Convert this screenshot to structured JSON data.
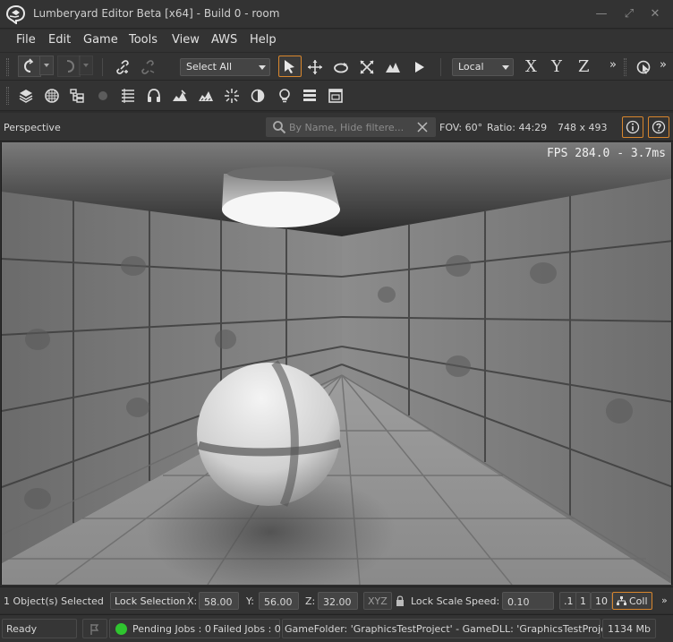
{
  "window": {
    "title": "Lumberyard Editor Beta [x64] - Build 0 - room",
    "minimize": "—",
    "maximize": "⤢",
    "close": "✕"
  },
  "menu": [
    "File",
    "Edit",
    "Game",
    "Tools",
    "View",
    "AWS",
    "Help"
  ],
  "toolbar": {
    "selection_filter": "Select All",
    "coordinate_space": "Local",
    "axis_x": "X",
    "axis_y": "Y",
    "axis_z": "Z",
    "overflow": "»"
  },
  "viewport": {
    "name": "Perspective",
    "search_placeholder": "By Name, Hide filtere...",
    "fov": "FOV: 60°",
    "ratio": "Ratio: 44:29",
    "resolution": "748 x 493",
    "fps_overlay": "FPS 284.0 - 3.7ms"
  },
  "status": {
    "selection_count": "1 Object(s) Selected",
    "lock_selection": "Lock Selection",
    "x_label": "X:",
    "x_value": "58.00",
    "y_label": "Y:",
    "y_value": "56.00",
    "z_label": "Z:",
    "z_value": "32.00",
    "xyz_button": "XYZ",
    "lock_scale": "Lock Scale",
    "speed_label": "Speed:",
    "speed_value": "0.10",
    "speed_presets": [
      ".1",
      "1",
      "10"
    ],
    "collision_button": "Coll",
    "overflow": "»"
  },
  "footer": {
    "state": "Ready",
    "pending_jobs": "Pending Jobs : 0",
    "failed_jobs": "Failed Jobs : 0",
    "game_info": "GameFolder: 'GraphicsTestProject' - GameDLL: 'GraphicsTestProject'",
    "memory": "1134 Mb"
  },
  "colors": {
    "accent": "#d8862d",
    "panel": "#333333",
    "status_ok": "#2fc52f"
  },
  "icons": {
    "toolbar1": [
      "undo-icon",
      "redo-icon",
      "link-icon",
      "unlink-icon",
      "select-arrow-icon",
      "move-icon",
      "rotate-icon",
      "scale-icon",
      "terrain-snap-icon",
      "play-icon",
      "snap-to-object-icon"
    ],
    "toolbar2": [
      "layers-icon",
      "material-icon",
      "hierarchy-icon",
      "lighting-icon",
      "track-view-icon",
      "audio-icon",
      "terrain-icon",
      "terrain-texture-icon",
      "particle-icon",
      "time-of-day-icon",
      "database-icon",
      "console-icon",
      "ui-editor-icon"
    ]
  }
}
